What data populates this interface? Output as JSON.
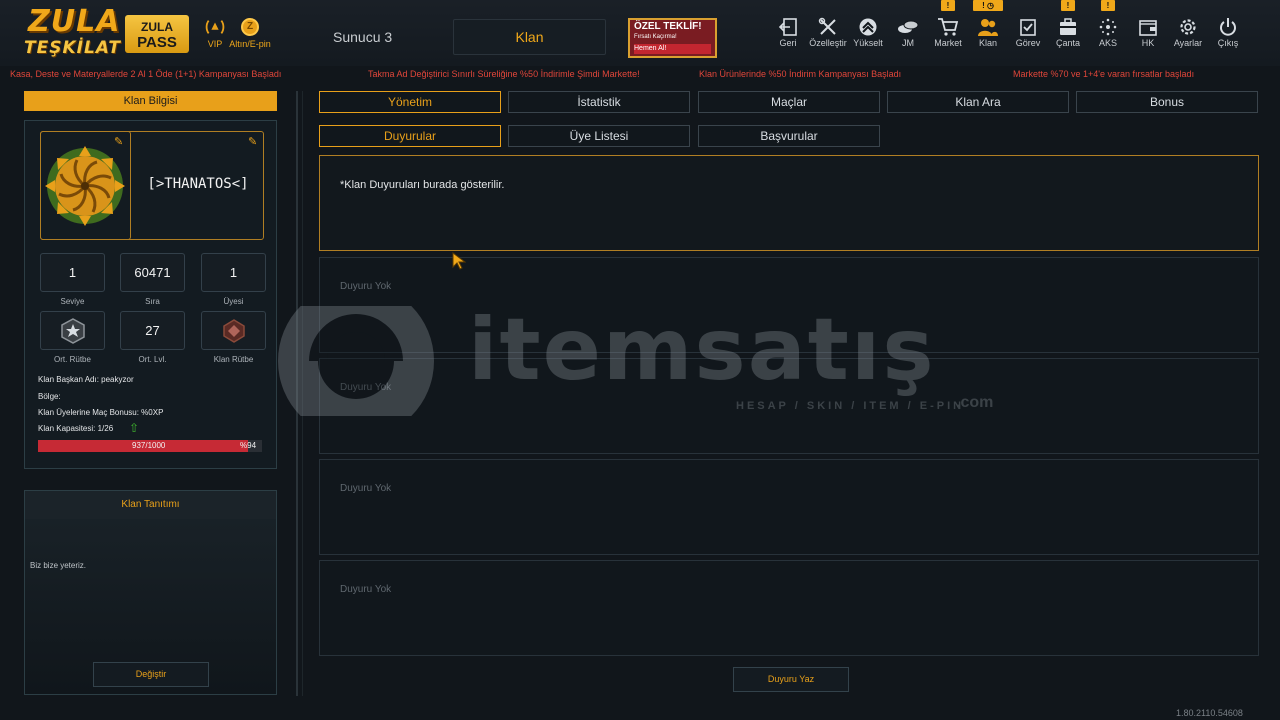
{
  "header": {
    "logo_line1": "ZULA",
    "logo_line2": "TEŞKİLAT",
    "pass_line1": "ZULA",
    "pass_line2": "PASS",
    "vip_label": "VIP",
    "gold_label": "Altın/E-pin",
    "server": "Sunucu 3",
    "section": "Klan",
    "offer_title": "ÖZEL TEKLİF!",
    "offer_sub": "Fırsatı Kaçırma!",
    "offer_cta": "Hemen Al!"
  },
  "nav": [
    {
      "label": "Geri",
      "icon": "back-icon"
    },
    {
      "label": "Özelleştir",
      "icon": "tools-icon"
    },
    {
      "label": "Yükselt",
      "icon": "upgrade-icon"
    },
    {
      "label": "JM",
      "icon": "coins-icon"
    },
    {
      "label": "Market",
      "icon": "cart-icon"
    },
    {
      "label": "Klan",
      "icon": "clan-icon"
    },
    {
      "label": "Görev",
      "icon": "task-icon"
    },
    {
      "label": "Çanta",
      "icon": "bag-icon"
    },
    {
      "label": "AKS",
      "icon": "aks-icon"
    },
    {
      "label": "HK",
      "icon": "wallet-icon"
    },
    {
      "label": "Ayarlar",
      "icon": "gear-icon"
    },
    {
      "label": "Çıkış",
      "icon": "power-icon"
    }
  ],
  "tickers": [
    "Kasa, Deste ve Materyallerde 2 Al 1 Öde (1+1) Kampanyası Başladı",
    "Takma Ad Değiştirici Sınırlı Süreliğine %50 İndirimle Şimdi Markette!",
    "Klan Ürünlerinde %50 İndirim Kampanyası Başladı",
    "Markette %70 ve 1+4'e varan fırsatlar başladı"
  ],
  "clan_info": {
    "title": "Klan Bilgisi",
    "name": "[>THANATOS<]",
    "stats": [
      {
        "value": "1",
        "label": "Seviye"
      },
      {
        "value": "60471",
        "label": "Sıra"
      },
      {
        "value": "1",
        "label": "Üyesi"
      },
      {
        "value": "",
        "label": "Ort. Rütbe"
      },
      {
        "value": "27",
        "label": "Ort. Lvl."
      },
      {
        "value": "",
        "label": "Klan Rütbe"
      }
    ],
    "leader": "Klan Başkan Adı:  peakyzor",
    "region": "Bölge:",
    "bonus": "Klan Üyelerine Maç Bonusu:  %0XP",
    "capacity": "Klan Kapasitesi: 1/26",
    "xp_text": "937/1000",
    "xp_percent_text": "%94",
    "xp_fraction": 0.937
  },
  "promo": {
    "title": "Klan Tanıtımı",
    "text": "Biz bize yeteriz.",
    "change_button": "Değiştir"
  },
  "tabs_main": [
    "Yönetim",
    "İstatistik",
    "Maçlar",
    "Klan Ara",
    "Bonus"
  ],
  "tabs_sub": [
    "Duyurular",
    "Üye Listesi",
    "Başvurular"
  ],
  "announcements": {
    "info": "*Klan Duyuruları burada gösterilir.",
    "empty": [
      "Duyuru Yok",
      "Duyuru Yok",
      "Duyuru Yok",
      "Duyuru Yok"
    ],
    "write_button": "Duyuru Yaz"
  },
  "watermark": {
    "brand": "itemsatış",
    "tagline": "HESAP / SKIN / ITEM / E-PIN",
    "suffix": ".com"
  },
  "version": "1.80.2110.54608",
  "colors": {
    "accent": "#e8a01a",
    "danger": "#c62a35",
    "background": "#11161b"
  }
}
